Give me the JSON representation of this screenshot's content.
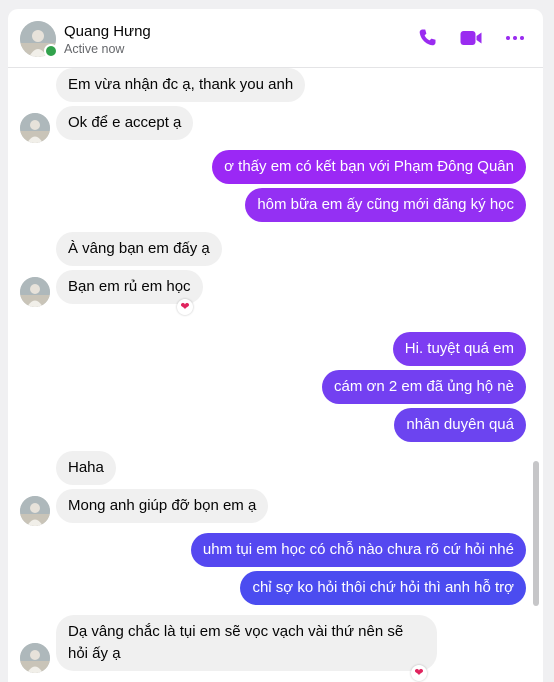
{
  "contact": {
    "name": "Quang Hưng",
    "status": "Active now"
  },
  "header_icons": {
    "call": "phone-icon",
    "video": "video-camera-icon",
    "more": "more-dots-icon"
  },
  "colors": {
    "accent": "#9a2cf0",
    "out_top": "#9b28f5",
    "out_mid": "#6d3ef0",
    "out_bottom": "#4b4cf0",
    "online": "#31a24c",
    "heart": "#e0245e"
  },
  "messages": [
    {
      "from": "them",
      "text": "Em vừa nhận đc ạ, thank you anh"
    },
    {
      "from": "them",
      "text": "Ok để e accept ạ"
    },
    {
      "from": "me",
      "text": "ơ thấy em có kết bạn với Phạm Đông Quân"
    },
    {
      "from": "me",
      "text": "hôm bữa em ấy cũng mới đăng ký học"
    },
    {
      "from": "them",
      "text": "À vâng bạn em đấy ạ"
    },
    {
      "from": "them",
      "text": "Bạn em rủ em học",
      "reaction": "❤"
    },
    {
      "from": "me",
      "text": "Hi. tuyệt quá em"
    },
    {
      "from": "me",
      "text": "cám ơn 2 em đã ủng hộ nè"
    },
    {
      "from": "me",
      "text": "nhân duyên quá"
    },
    {
      "from": "them",
      "text": "Haha"
    },
    {
      "from": "them",
      "text": "Mong anh giúp đỡ bọn em ạ"
    },
    {
      "from": "me",
      "text": "uhm tụi em học có chỗ nào chưa rõ cứ hỏi nhé"
    },
    {
      "from": "me",
      "text": "chỉ sợ ko hỏi thôi chứ hỏi thì anh hỗ trợ"
    },
    {
      "from": "them",
      "text": "Dạ vâng chắc là tụi em sẽ vọc vạch vài thứ nên sẽ hỏi ấy ạ",
      "reaction": "❤"
    }
  ]
}
